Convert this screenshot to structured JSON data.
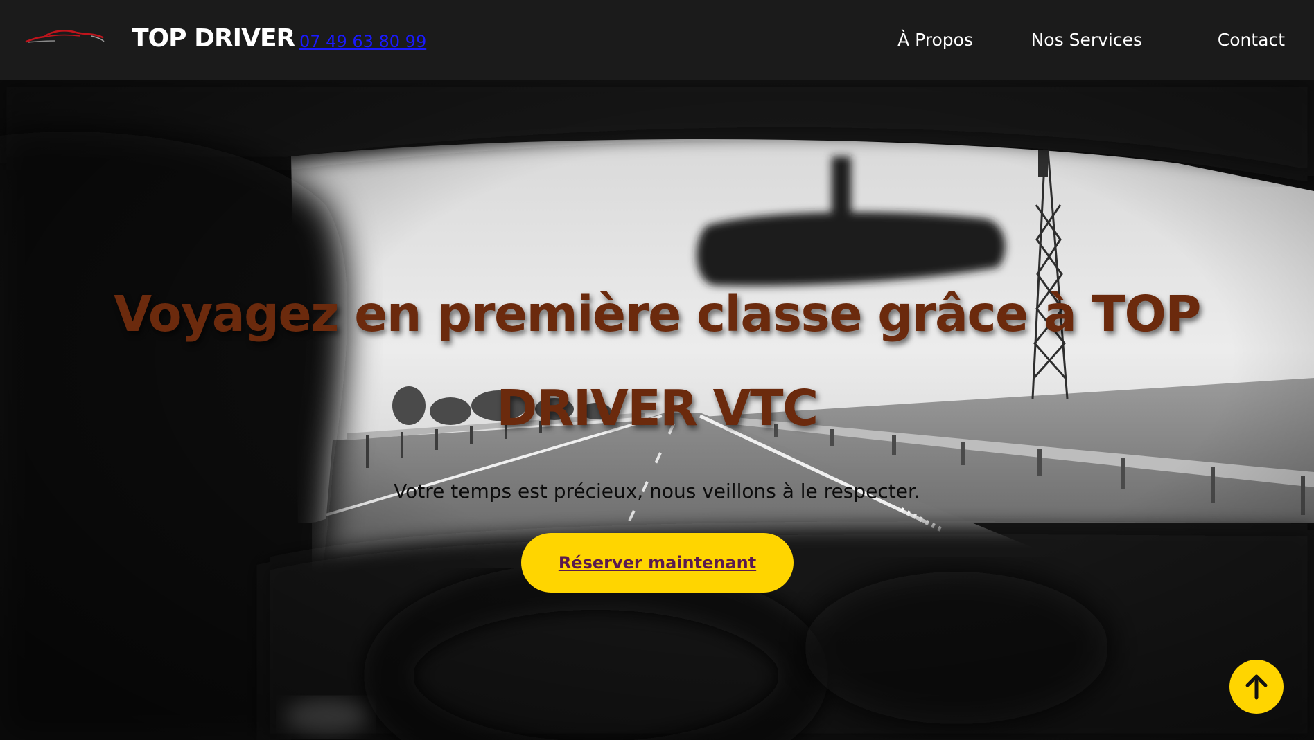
{
  "header": {
    "brand_name": "TOP DRIVER",
    "phone": "07 49 63 80 99",
    "logo_icon": "sports-car-icon",
    "nav": [
      {
        "label": "À Propos"
      },
      {
        "label": "Nos Services"
      },
      {
        "label": "Contact"
      }
    ]
  },
  "hero": {
    "title_line1": "Voyagez en première classe grâce à TOP",
    "title_line2": "DRIVER VTC",
    "subtitle": "Votre temps est précieux, nous veillons à le respecter.",
    "cta_label": "Réserver maintenant",
    "background_icon": "car-interior-road-photo"
  },
  "scroll_top": {
    "icon": "arrow-up-icon"
  },
  "colors": {
    "header_bg": "#1b1b1b",
    "accent_yellow": "#ffd500",
    "title_brown": "#6b2a0d",
    "cta_text": "#5a1a4e",
    "phone_link": "#1a1aff"
  }
}
